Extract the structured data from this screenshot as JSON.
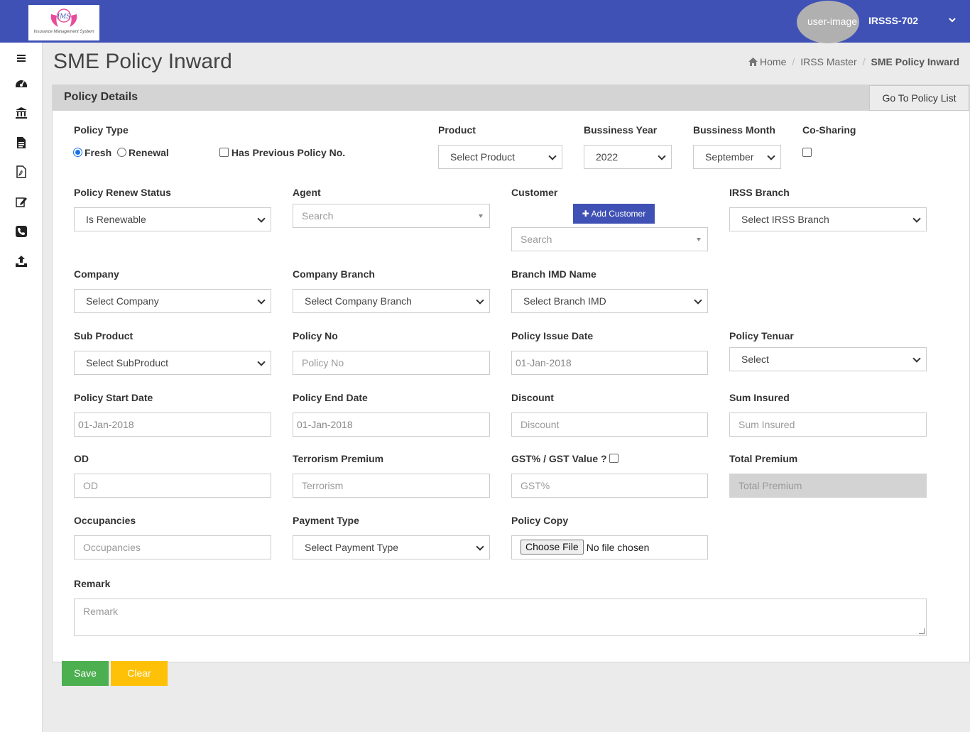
{
  "header": {
    "logo_text": "IMS",
    "logo_tagline": "Insurance Management System",
    "user_image_alt": "user-image",
    "user_name": "IRSSS-702",
    "colors": {
      "primary": "#3f51b5",
      "save": "#4caf50",
      "clear": "#ffc107"
    }
  },
  "sidebar": {
    "icons": [
      "menu-icon",
      "dashboard-icon",
      "bank-icon",
      "document-icon",
      "pdf-icon",
      "edit-icon",
      "phone-icon",
      "upload-icon"
    ]
  },
  "page": {
    "title": "SME Policy Inward",
    "breadcrumb": {
      "home": "Home",
      "parent": "IRSS Master",
      "current": "SME Policy Inward"
    }
  },
  "card": {
    "title": "Policy Details",
    "goto_button": "Go To Policy List"
  },
  "form": {
    "policy_type": {
      "label": "Policy Type",
      "options": [
        "Fresh",
        "Renewal"
      ],
      "selected": "Fresh"
    },
    "has_previous": {
      "label": "Has Previous Policy No.",
      "checked": false
    },
    "product": {
      "label": "Product",
      "value": "Select Product"
    },
    "business_year": {
      "label": "Bussiness Year",
      "value": "2022"
    },
    "business_month": {
      "label": "Bussiness Month",
      "value": "September"
    },
    "co_sharing": {
      "label": "Co-Sharing",
      "checked": false
    },
    "renew_status": {
      "label": "Policy Renew Status",
      "value": "Is Renewable"
    },
    "agent": {
      "label": "Agent",
      "placeholder": "Search"
    },
    "customer": {
      "label": "Customer",
      "add_button": "Add Customer",
      "placeholder": "Search"
    },
    "irss_branch": {
      "label": "IRSS Branch",
      "value": "Select IRSS Branch"
    },
    "company": {
      "label": "Company",
      "value": "Select Company"
    },
    "company_branch": {
      "label": "Company Branch",
      "value": "Select Company Branch"
    },
    "branch_imd": {
      "label": "Branch IMD Name",
      "value": "Select Branch IMD"
    },
    "sub_product": {
      "label": "Sub Product",
      "value": "Select SubProduct"
    },
    "policy_no": {
      "label": "Policy No",
      "placeholder": "Policy No"
    },
    "issue_date": {
      "label": "Policy Issue Date",
      "value": "01-Jan-2018"
    },
    "tenure": {
      "label": "Policy Tenuar",
      "value": "Select"
    },
    "start_date": {
      "label": "Policy Start Date",
      "value": "01-Jan-2018"
    },
    "end_date": {
      "label": "Policy End Date",
      "value": "01-Jan-2018"
    },
    "discount": {
      "label": "Discount",
      "placeholder": "Discount"
    },
    "sum_insured": {
      "label": "Sum Insured",
      "placeholder": "Sum Insured"
    },
    "od": {
      "label": "OD",
      "placeholder": "OD"
    },
    "terrorism": {
      "label": "Terrorism Premium",
      "placeholder": "Terrorism"
    },
    "gst": {
      "label": "GST% / GST Value ?",
      "placeholder": "GST%",
      "checked": false
    },
    "total_premium": {
      "label": "Total Premium",
      "placeholder": "Total Premium"
    },
    "occupancies": {
      "label": "Occupancies",
      "placeholder": "Occupancies"
    },
    "payment_type": {
      "label": "Payment Type",
      "value": "Select Payment Type"
    },
    "policy_copy": {
      "label": "Policy Copy",
      "button": "Choose File",
      "status": "No file chosen"
    },
    "remark": {
      "label": "Remark",
      "placeholder": "Remark"
    }
  },
  "actions": {
    "save": "Save",
    "clear": "Clear"
  }
}
